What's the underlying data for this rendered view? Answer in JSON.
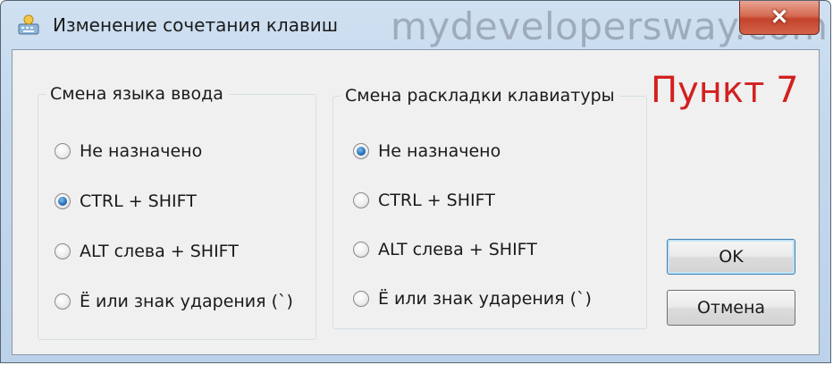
{
  "window": {
    "title": "Изменение сочетания клавиш",
    "watermark": "mydevelopersway.com",
    "close_label": "✕"
  },
  "annotation": "Пункт 7",
  "input_language": {
    "legend": "Смена языка ввода",
    "options": [
      {
        "label": "Не назначено",
        "checked": false
      },
      {
        "label": "CTRL + SHIFT",
        "checked": true
      },
      {
        "label": "ALT слева + SHIFT",
        "checked": false
      },
      {
        "label": "Ё или знак ударения (`)",
        "checked": false
      }
    ]
  },
  "keyboard_layout": {
    "legend": "Смена раскладки клавиатуры",
    "options": [
      {
        "label": "Не назначено",
        "checked": true
      },
      {
        "label": "CTRL + SHIFT",
        "checked": false
      },
      {
        "label": "ALT слева + SHIFT",
        "checked": false
      },
      {
        "label": "Ё или знак ударения (`)",
        "checked": false
      }
    ]
  },
  "buttons": {
    "ok": "OK",
    "cancel": "Отмена"
  },
  "colors": {
    "annotation": "#d32020",
    "radio_selected": "#2a73b8"
  },
  "icons": {
    "title": "keyboard-app-icon",
    "close": "close-icon"
  }
}
